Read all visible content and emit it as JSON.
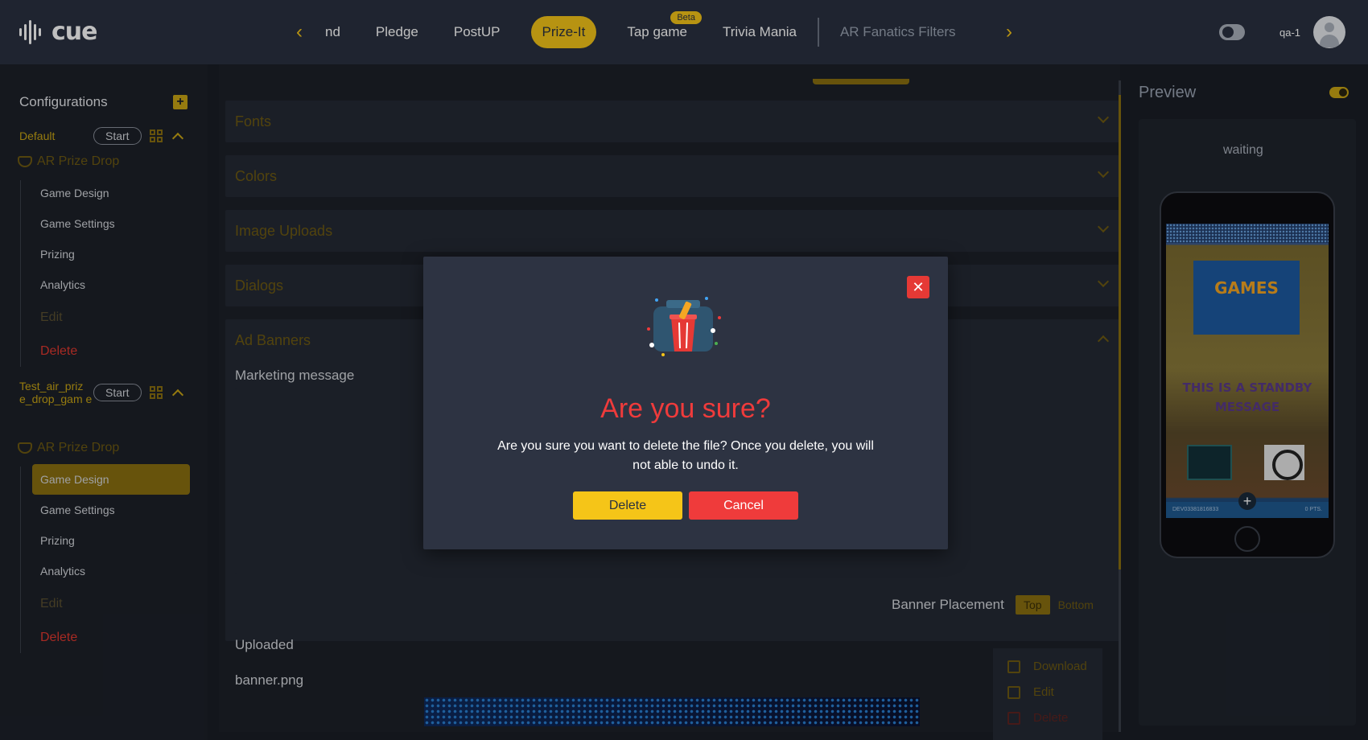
{
  "app": {
    "logo_text": "cue"
  },
  "nav": {
    "items": [
      {
        "label": "nd"
      },
      {
        "label": "Pledge"
      },
      {
        "label": "PostUP"
      },
      {
        "label": "Prize-It"
      },
      {
        "label": "Tap game",
        "badge": "Beta"
      },
      {
        "label": "Trivia Mania"
      },
      {
        "label": "AR Fanatics Filters"
      }
    ],
    "active_index": 3
  },
  "user": {
    "name": "qa-1"
  },
  "sidebar": {
    "title": "Configurations",
    "configs": [
      {
        "name": "Default",
        "start_label": "Start",
        "game": "AR Prize Drop",
        "links": [
          "Game Design",
          "Game Settings",
          "Prizing",
          "Analytics"
        ],
        "edit": "Edit",
        "delete": "Delete"
      },
      {
        "name": "Test_air_priz e_drop_gam e",
        "start_label": "Start",
        "game": "AR Prize Drop",
        "links": [
          "Game Design",
          "Game Settings",
          "Prizing",
          "Analytics"
        ],
        "edit": "Edit",
        "delete": "Delete",
        "active_link": "Game Design"
      }
    ]
  },
  "main": {
    "sections": [
      "Fonts",
      "Colors",
      "Image Uploads",
      "Dialogs",
      "Ad Banners"
    ],
    "marketing_label": "Marketing message",
    "placement_label": "Banner Placement",
    "placement_options": [
      "Top",
      "Bottom"
    ],
    "placement_selected": "Top",
    "uploaded_label": "Uploaded",
    "file_name": "banner.png",
    "file_menu": [
      "Download",
      "Edit",
      "Delete"
    ]
  },
  "preview": {
    "title": "Preview",
    "status": "waiting",
    "phone": {
      "logo_text": "GAMES",
      "message": "THIS IS A STANDBY MESSAGE",
      "player_id": "DEV03381816833",
      "points": "0 PTS."
    }
  },
  "modal": {
    "title": "Are you sure?",
    "message": "Are you sure you want to delete the file? Once you delete, you will not able to undo it.",
    "confirm_label": "Delete",
    "cancel_label": "Cancel"
  },
  "colors": {
    "accent": "#f5c518",
    "danger": "#ef3b3b",
    "topbar": "#2a3140",
    "background": "#1a1e26"
  }
}
